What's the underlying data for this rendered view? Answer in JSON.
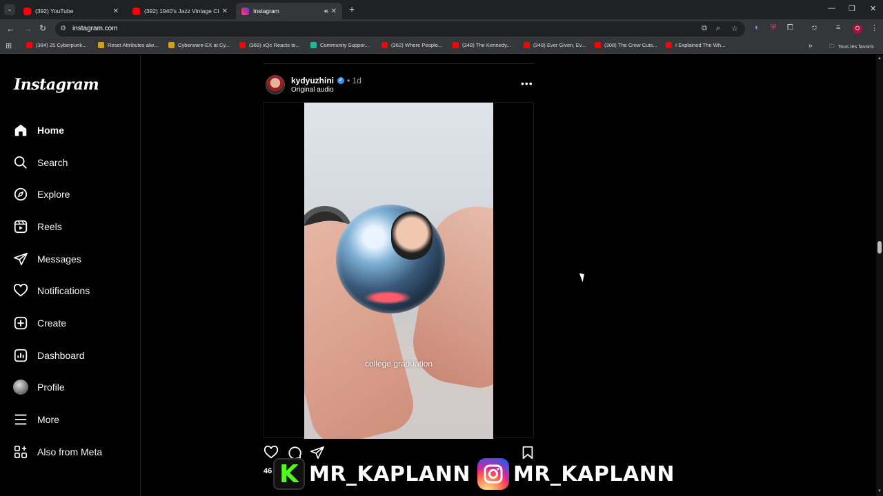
{
  "browser": {
    "tabs": [
      {
        "title": "(392) YouTube",
        "favicon_color": "#ff0000"
      },
      {
        "title": "(392) 1940's Jazz Vintage Classic",
        "favicon_color": "#ff0000"
      },
      {
        "title": "Instagram",
        "favicon_color": "#d6249f",
        "active": true
      }
    ],
    "url": "instagram.com",
    "bookmarks": [
      {
        "label": "(384) 25 Cyberpunk...",
        "color": "#ff0000"
      },
      {
        "label": "Reset Attributes alw...",
        "color": "#d4a017"
      },
      {
        "label": "Cyberware-EX at Cy...",
        "color": "#d4a017"
      },
      {
        "label": "(369) xQc Reacts to...",
        "color": "#ff0000"
      },
      {
        "label": "Community Suppor...",
        "color": "#1abc9c"
      },
      {
        "label": "(362) Where People...",
        "color": "#ff0000"
      },
      {
        "label": "(348) The Kennedy...",
        "color": "#ff0000"
      },
      {
        "label": "(348) Ever Given, Ev...",
        "color": "#ff0000"
      },
      {
        "label": "(308) The Crew Cuts...",
        "color": "#ff0000"
      },
      {
        "label": "I Explained The Wh...",
        "color": "#ff0000"
      }
    ],
    "bookmarks_folder": "Tous les favoris",
    "profile_initial": "O"
  },
  "instagram": {
    "logo": "Instagram",
    "nav": [
      {
        "label": "Home",
        "icon": "home-icon"
      },
      {
        "label": "Search",
        "icon": "search-icon"
      },
      {
        "label": "Explore",
        "icon": "compass-icon"
      },
      {
        "label": "Reels",
        "icon": "reels-icon"
      },
      {
        "label": "Messages",
        "icon": "messages-icon"
      },
      {
        "label": "Notifications",
        "icon": "heart-icon"
      },
      {
        "label": "Create",
        "icon": "create-icon"
      },
      {
        "label": "Dashboard",
        "icon": "dashboard-icon"
      },
      {
        "label": "Profile",
        "icon": "profile-avatar"
      },
      {
        "label": "More",
        "icon": "menu-icon"
      },
      {
        "label": "Also from Meta",
        "icon": "meta-icon"
      }
    ],
    "post": {
      "username": "kydyuzhini",
      "time": "• 1d",
      "audio": "Original audio",
      "caption_overlay": "college graduation",
      "likes_prefix": "46"
    }
  },
  "overlay": {
    "kick_letter": "K",
    "name1": "MR_KAPLANN",
    "name2": "MR_KAPLANN"
  }
}
